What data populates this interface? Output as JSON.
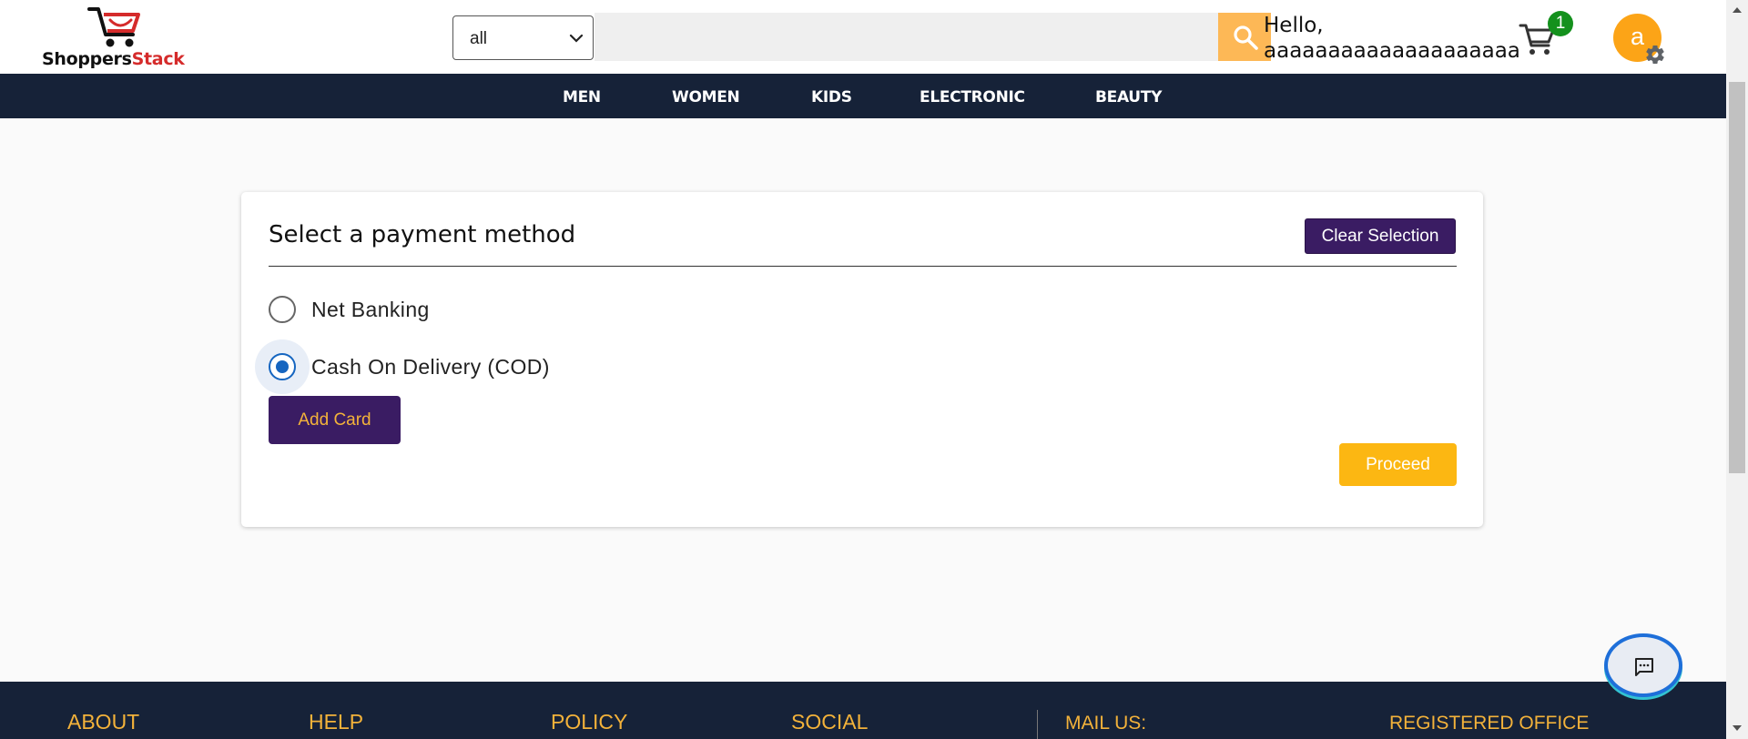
{
  "header": {
    "logo_text_a": "Shoppers",
    "logo_text_b": "Stack",
    "category_select": "all",
    "greeting": "Hello,",
    "username": "aaaaaaaaaaaaaaaaaaaa",
    "cart_count": "1",
    "avatar_letter": "a"
  },
  "nav": {
    "items": [
      "MEN",
      "WOMEN",
      "KIDS",
      "ELECTRONIC",
      "BEAUTY"
    ]
  },
  "payment": {
    "title": "Select a payment method",
    "clear_label": "Clear Selection",
    "options": [
      {
        "label": "Net Banking",
        "selected": false
      },
      {
        "label": "Cash On Delivery (COD)",
        "selected": true
      }
    ],
    "add_card_label": "Add Card",
    "proceed_label": "Proceed"
  },
  "footer": {
    "headings": [
      "ABOUT",
      "HELP",
      "POLICY",
      "SOCIAL",
      "MAIL US:",
      "REGISTERED OFFICE ADDRESS"
    ]
  },
  "colors": {
    "nav_bg": "#162238",
    "accent_purple": "#3a1c63",
    "accent_yellow": "#fcb712",
    "radio_blue": "#1565c0"
  }
}
